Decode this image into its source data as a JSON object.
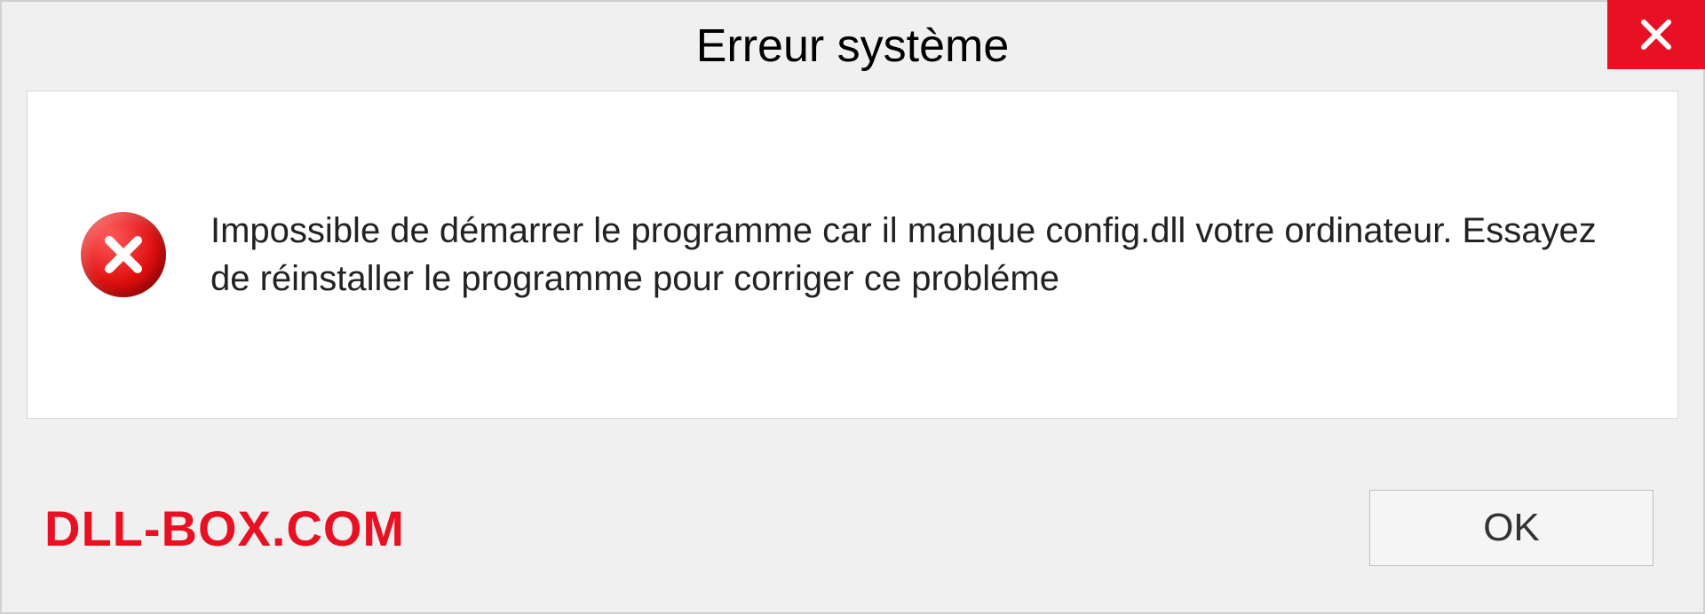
{
  "dialog": {
    "title": "Erreur système",
    "message": "Impossible de démarrer le programme car il manque config.dll votre ordinateur. Essayez de réinstaller le programme pour corriger ce probléme",
    "ok_label": "OK",
    "watermark": "DLL-BOX.COM"
  },
  "colors": {
    "error_red": "#e81123",
    "background": "#f0f0f0",
    "content_bg": "#ffffff"
  }
}
